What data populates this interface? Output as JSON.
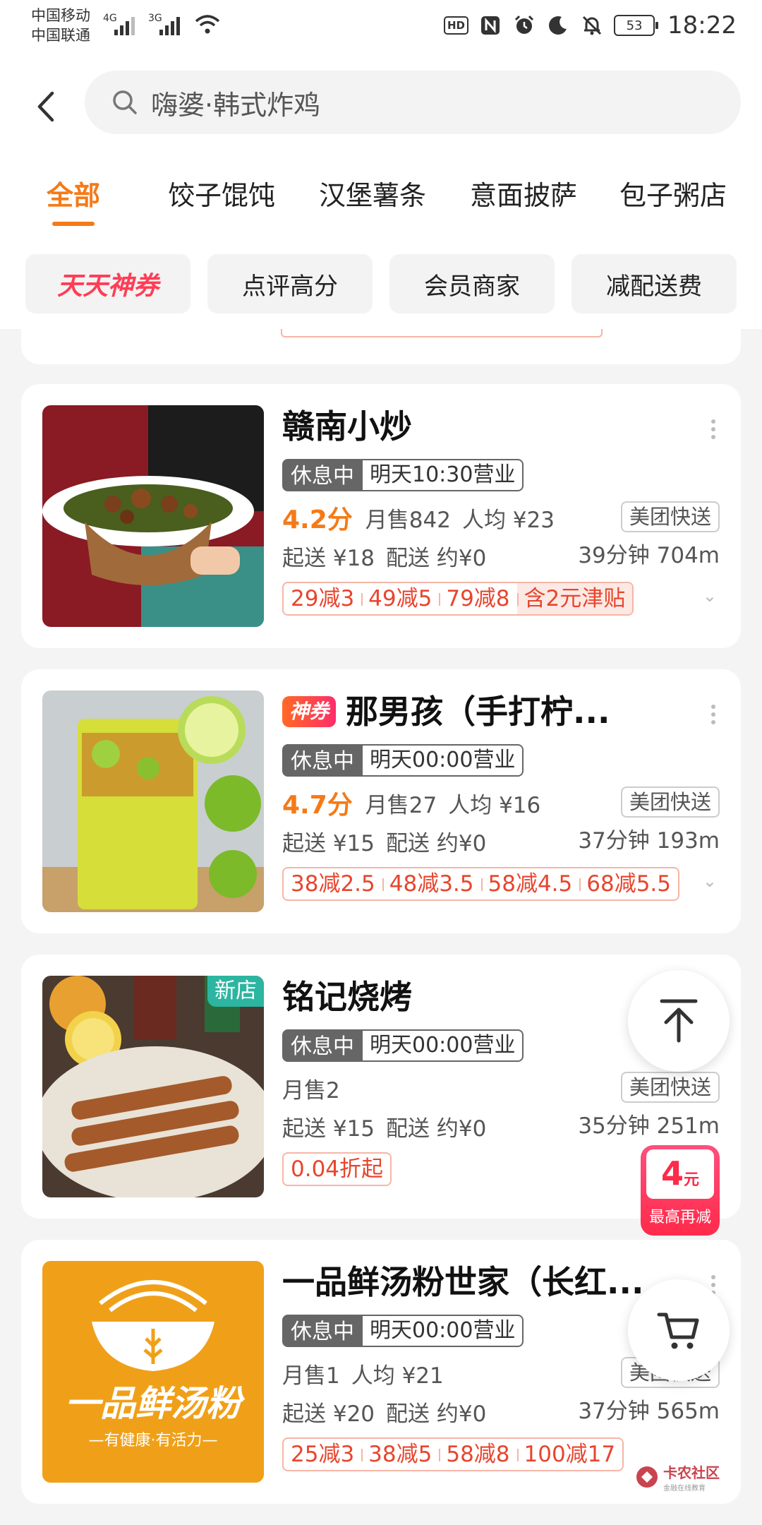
{
  "status_bar": {
    "carrier1": "中国移动",
    "carrier2": "中国联通",
    "net1": "4G",
    "net2": "3G",
    "hd": "HD",
    "battery": "53",
    "time": "18:22"
  },
  "search": {
    "query": "嗨婆·韩式炸鸡"
  },
  "tabs": [
    "全部",
    "饺子馄饨",
    "汉堡薯条",
    "意面披萨",
    "包子粥店"
  ],
  "filters": [
    "天天神券",
    "点评高分",
    "会员商家",
    "减配送费"
  ],
  "stores": [
    {
      "name": "赣南小炒",
      "rest": "休息中",
      "open": "明天10:30营业",
      "rating": "4.2分",
      "sales": "月售842",
      "avg": "人均 ¥23",
      "delivery_tag": "美团快送",
      "min_order": "起送 ¥18",
      "fee": "配送 约¥0",
      "time_dist": "39分钟 704m",
      "promos": [
        "29减3",
        "49减5",
        "79减8"
      ],
      "subsidy": "含2元津贴"
    },
    {
      "badge": "神券",
      "name": "那男孩（手打柠...",
      "rest": "休息中",
      "open": "明天00:00营业",
      "rating": "4.7分",
      "sales": "月售27",
      "avg": "人均 ¥16",
      "delivery_tag": "美团快送",
      "min_order": "起送 ¥15",
      "fee": "配送 约¥0",
      "time_dist": "37分钟 193m",
      "promos": [
        "38减2.5",
        "48减3.5",
        "58减4.5",
        "68减5.5"
      ]
    },
    {
      "new_badge": "新店",
      "name": "铭记烧烤",
      "rest": "休息中",
      "open": "明天00:00营业",
      "sales": "月售2",
      "delivery_tag": "美团快送",
      "min_order": "起送 ¥15",
      "fee": "配送 约¥0",
      "time_dist": "35分钟 251m",
      "promos": [
        "0.04折起"
      ]
    },
    {
      "name": "一品鲜汤粉世家（长红...",
      "rest": "休息中",
      "open": "明天00:00营业",
      "sales": "月售1",
      "avg": "人均 ¥21",
      "delivery_tag": "美团快送",
      "min_order": "起送 ¥20",
      "fee": "配送 约¥0",
      "time_dist": "37分钟 565m",
      "promos": [
        "25减3",
        "38减5",
        "58减8",
        "100减17"
      ],
      "logo_text": "一品鲜汤粉",
      "logo_sub": "—有健康·有活力—"
    }
  ],
  "coupon_float": {
    "amount": "4",
    "unit": "元",
    "label": "最高再减"
  },
  "watermark": {
    "title": "卡农社区",
    "sub": "金融在线教育"
  },
  "colors": {
    "accent": "#f57a17",
    "promo_red": "#e8452e",
    "new_badge": "#2cb5a0"
  }
}
